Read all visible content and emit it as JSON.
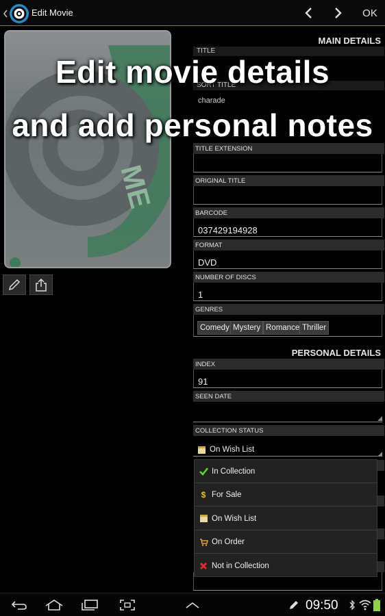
{
  "actionbar": {
    "title": "Edit Movie",
    "ok_label": "OK",
    "accent_color": "#2a8cc4"
  },
  "headline": {
    "line1": "Edit movie details",
    "line2": "and add personal notes"
  },
  "main_details": {
    "header": "MAIN DETAILS",
    "ghost_labels": [
      "TITLE",
      "SORT TITLE"
    ],
    "ghost_value": "charade",
    "fields": [
      {
        "label": "TITLE EXTENSION",
        "value": ""
      },
      {
        "label": "ORIGINAL TITLE",
        "value": ""
      },
      {
        "label": "BARCODE",
        "value": "037429194928"
      },
      {
        "label": "FORMAT",
        "value": "DVD"
      },
      {
        "label": "NUMBER OF DISCS",
        "value": "1"
      }
    ],
    "genres_label": "GENRES",
    "genres": [
      "Comedy",
      "Mystery",
      "Romance",
      "Thriller"
    ]
  },
  "personal_details": {
    "header": "PERSONAL DETAILS",
    "index_label": "INDEX",
    "index_value": "91",
    "seen_date_label": "SEEN DATE",
    "seen_date_value": "",
    "collection_status_label": "COLLECTION STATUS",
    "collection_status_value": "On Wish List"
  },
  "collection_status_options": [
    {
      "label": "In Collection",
      "icon": "checkmark-icon"
    },
    {
      "label": "For Sale",
      "icon": "dollar-icon"
    },
    {
      "label": "On Wish List",
      "icon": "note-icon"
    },
    {
      "label": "On Order",
      "icon": "cart-icon"
    },
    {
      "label": "Not in Collection",
      "icon": "red-x-icon"
    }
  ],
  "statusbar": {
    "time": "09:50"
  }
}
